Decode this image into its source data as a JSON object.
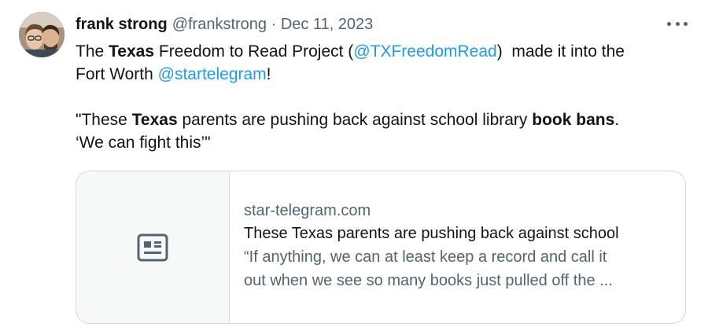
{
  "tweet": {
    "author_name": "frank strong",
    "handle_date": "@frankstrong · Dec 11, 2023",
    "line1": {
      "t1": "The ",
      "b1": "Texas",
      "t2": " Freedom to Read Project (",
      "mention1": "@TXFreedomRead",
      "t3": ")  made it into the"
    },
    "line2": {
      "t1": "Fort Worth ",
      "mention2": "@startelegram",
      "t2": "!"
    },
    "quote": {
      "t1": "\"These ",
      "b1": "Texas",
      "t2": " parents are pushing back against school library ",
      "b2": "book bans",
      "t3": ".",
      "line2": "‘We can fight this’\""
    },
    "colors": {
      "text": "#0f1419",
      "secondary": "#536471",
      "link": "#1d9bf0",
      "border": "#cfd9de"
    }
  },
  "card": {
    "domain": "star-telegram.com",
    "title": "These Texas parents are pushing back against school",
    "desc_line1": "“If anything, we can at least keep a record and call it",
    "desc_line2": "out when we see so many books just pulled off the ...",
    "icon": "newspaper-icon"
  },
  "more_icon": "more-options-icon"
}
